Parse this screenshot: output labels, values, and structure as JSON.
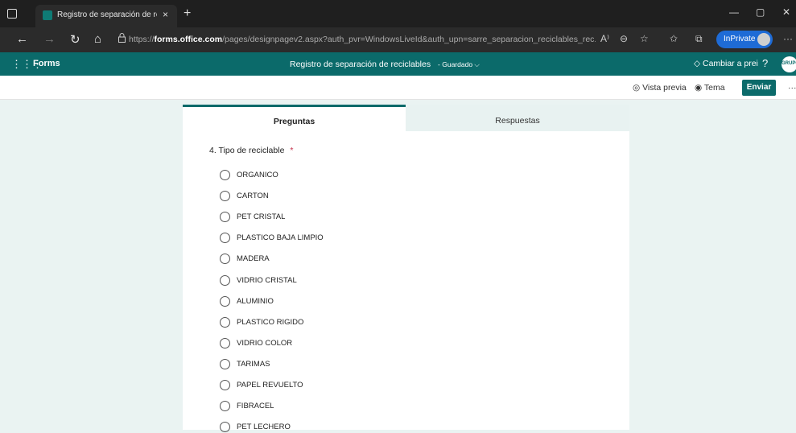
{
  "browser": {
    "tab_title": "Registro de separación de reciclables",
    "tab_close": "×",
    "new_tab": "+",
    "url_prefix": "https://",
    "url_host": "forms.office.com",
    "url_rest": "/pages/designpagev2.aspx?auth_pvr=WindowsLiveId&auth_upn=sarre_separacion_reciclables_rec...",
    "inprivate_label": "InPrivate",
    "window_controls": [
      "—",
      "▢",
      "✕"
    ]
  },
  "app": {
    "name": "Forms",
    "form_title": "Registro de separación de reciclables",
    "status": "Guardado",
    "upgrade_label": "Cambiar a prei",
    "help": "?",
    "logo_text": "GRUPO"
  },
  "toolbar": {
    "preview_label": "Vista previa",
    "theme_label": "Tema",
    "send_label": "Enviar",
    "more": "···"
  },
  "tabs": {
    "questions": "Preguntas",
    "responses": "Respuestas"
  },
  "question": {
    "number": "4.",
    "text": "Tipo de reciclable",
    "required_marker": "*",
    "options": [
      "ORGANICO",
      "CARTON",
      "PET CRISTAL",
      "PLASTICO BAJA LIMPIO",
      "MADERA",
      "VIDRIO CRISTAL",
      "ALUMINIO",
      "PLASTICO RIGIDO",
      "VIDRIO COLOR",
      "TARIMAS",
      "PAPEL REVUELTO",
      "FIBRACEL",
      "PET LECHERO"
    ]
  },
  "colors": {
    "brand": "#0b6a6a",
    "page_bg": "#eaf3f2",
    "required": "#c4314b"
  }
}
